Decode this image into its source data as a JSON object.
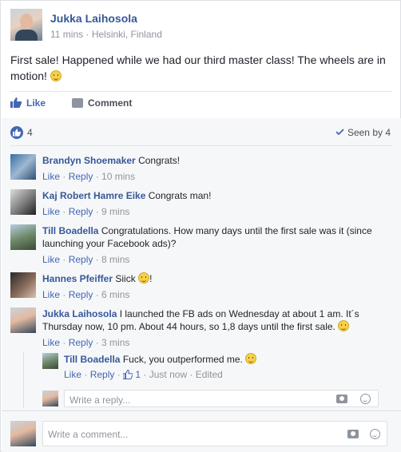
{
  "post": {
    "author": "Jukka Laihosola",
    "time": "11 mins",
    "separator": "·",
    "location": "Helsinki, Finland",
    "text": "First sale! Happened while we had our third master class! The wheels are in motion!"
  },
  "actions": {
    "like": "Like",
    "comment": "Comment"
  },
  "summary": {
    "like_count": "4",
    "seen": "Seen by 4"
  },
  "comments": [
    {
      "name": "Brandyn Shoemaker",
      "text": "Congrats!",
      "like": "Like",
      "reply": "Reply",
      "time": "10 mins"
    },
    {
      "name": "Kaj Robert Hamre Eike",
      "text": "Congrats man!",
      "like": "Like",
      "reply": "Reply",
      "time": "9 mins"
    },
    {
      "name": "Till Boadella",
      "text": "Congratulations. How many days until the first sale was it (since launching your Facebook ads)?",
      "like": "Like",
      "reply": "Reply",
      "time": "8 mins"
    },
    {
      "name": "Hannes Pfeiffer",
      "text": "Siick",
      "text_after": "!",
      "like": "Like",
      "reply": "Reply",
      "time": "6 mins"
    },
    {
      "name": "Jukka Laihosola",
      "text": "I launched the FB ads on Wednesday at about 1 am. It´s Thursday now, 10 pm. About 44 hours, so 1,8 days until the first sale.",
      "like": "Like",
      "reply": "Reply",
      "time": "3 mins"
    }
  ],
  "reply": {
    "name": "Till Boadella",
    "text": "Fuck, you outperformed me.",
    "like": "Like",
    "reply": "Reply",
    "like_count": "1",
    "time": "Just now",
    "edited": "Edited"
  },
  "reply_input": {
    "placeholder": "Write a reply..."
  },
  "comment_input": {
    "placeholder": "Write a comment..."
  },
  "colors": {
    "link": "#365899",
    "accent": "#4267b2",
    "muted": "#90949c"
  },
  "icons": [
    "like-icon",
    "comment-icon",
    "check-icon",
    "camera-icon",
    "smile-icon",
    "globe-icon"
  ]
}
